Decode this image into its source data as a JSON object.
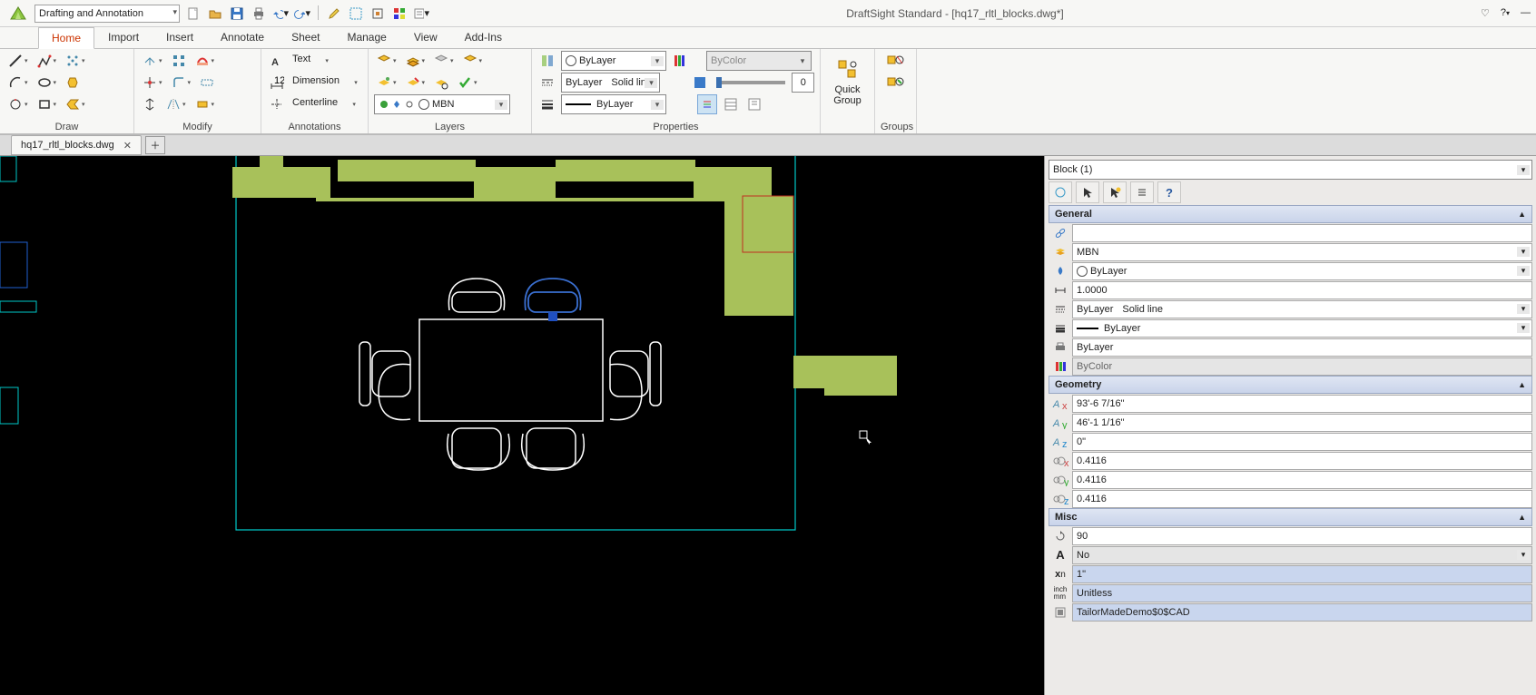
{
  "app": {
    "title": "DraftSight Standard - [hq17_rltl_blocks.dwg*]"
  },
  "workspace": {
    "current": "Drafting and Annotation"
  },
  "qat": {
    "items": [
      "new",
      "open",
      "save",
      "print",
      "undo",
      "redo",
      "sep",
      "highlight",
      "rebuild",
      "block",
      "color-blocks",
      "options"
    ]
  },
  "menu_tabs": [
    "Home",
    "Import",
    "Insert",
    "Annotate",
    "Sheet",
    "Manage",
    "View",
    "Add-Ins"
  ],
  "menu_active": "Home",
  "ribbon": {
    "groups": [
      "Draw",
      "Modify",
      "Annotations",
      "Layers",
      "Properties",
      "",
      "Groups"
    ],
    "annotations": {
      "text": "Text",
      "dimension": "Dimension",
      "centerline": "Centerline"
    },
    "layers": {
      "current": "MBN"
    },
    "properties": {
      "color": "ByLayer",
      "linetype_left": "ByLayer",
      "linetype_right": "Solid line",
      "lineweight": "ByLayer",
      "bycolor": "ByColor",
      "transparency": "0"
    },
    "quickgroup": "Quick Group"
  },
  "filetab": {
    "name": "hq17_rltl_blocks.dwg"
  },
  "props": {
    "selection": "Block (1)",
    "sections": {
      "general": "General",
      "geometry": "Geometry",
      "misc": "Misc"
    },
    "general": {
      "hyperlink": "",
      "layer": "MBN",
      "linecolor": "ByLayer",
      "linescale": "1.0000",
      "linestyle_left": "ByLayer",
      "linestyle_right": "Solid line",
      "lineweight": "ByLayer",
      "printstyle": "ByLayer",
      "bycolor": "ByColor"
    },
    "geometry": {
      "x": "93'-6 7/16\"",
      "y": "46'-1 1/16\"",
      "z": "0\"",
      "sx": "0.4116",
      "sy": "0.4116",
      "sz": "0.4116"
    },
    "misc": {
      "rotation": "90",
      "annotative": "No",
      "unitfactor": "1\"",
      "units": "Unitless",
      "name": "TailorMadeDemo$0$CAD"
    }
  }
}
